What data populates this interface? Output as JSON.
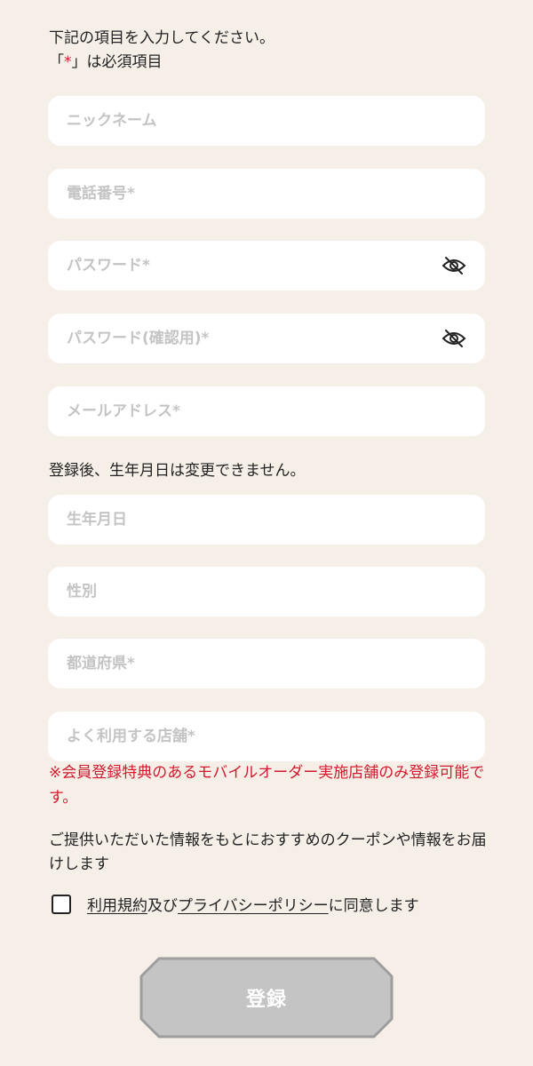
{
  "intro": {
    "line1": "下記の項目を入力してください。",
    "line2_open": "「",
    "line2_mark": "*",
    "line2_close": "」は必須項目"
  },
  "fields": {
    "nickname": {
      "placeholder": "ニックネーム"
    },
    "phone": {
      "placeholder": "電話番号*"
    },
    "password": {
      "placeholder": "パスワード*",
      "icon": "eye-off-icon"
    },
    "password_confirm": {
      "placeholder": "パスワード(確認用)*",
      "icon": "eye-off-icon"
    },
    "email": {
      "placeholder": "メールアドレス*"
    },
    "birthdate": {
      "placeholder": "生年月日"
    },
    "gender": {
      "placeholder": "性別"
    },
    "prefecture": {
      "placeholder": "都道府県*"
    },
    "store": {
      "placeholder": "よく利用する店舗*"
    }
  },
  "notes": {
    "birthdate_note": "登録後、生年月日は変更できません。",
    "store_note": "※会員登録特典のあるモバイルオーダー実施店舗のみ登録可能です。",
    "info_note": "ご提供いただいた情報をもとにおすすめのクーポンや情報をお届けします"
  },
  "consent": {
    "terms_link": "利用規約",
    "and_text": "及び",
    "privacy_link": "プライバシーポリシー",
    "agree_text": "に同意します"
  },
  "submit": {
    "label": "登録"
  },
  "colors": {
    "background": "#f6efe8",
    "field_bg": "#ffffff",
    "placeholder": "#c4c4c4",
    "required_red": "#d21a2f",
    "button_fill": "#c4c4c4",
    "button_border": "#9d9d9d"
  }
}
